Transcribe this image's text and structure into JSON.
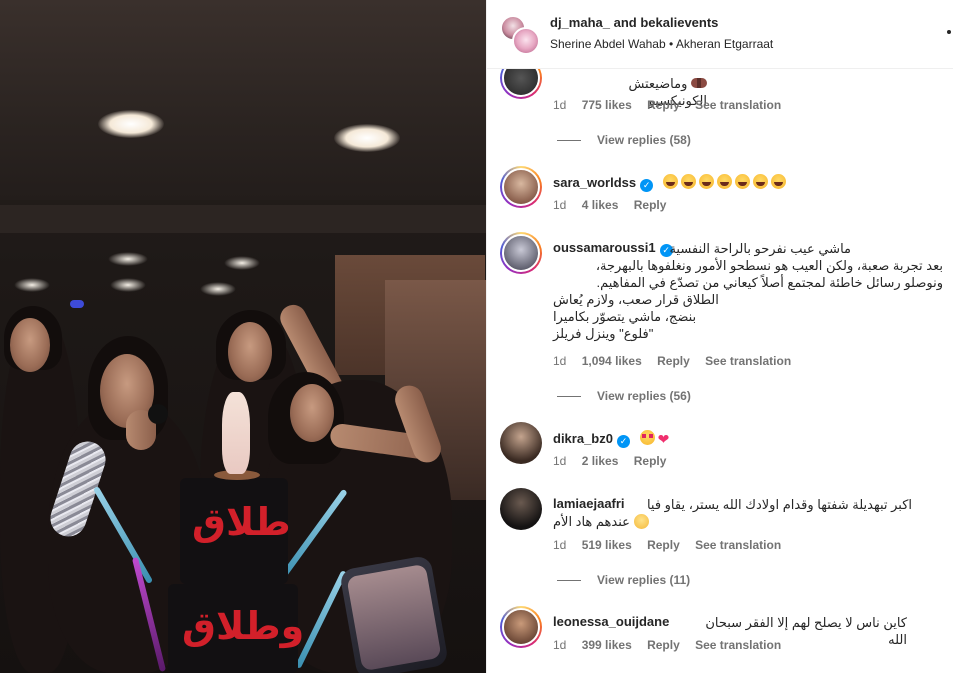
{
  "post": {
    "author_primary": "dj_maha_",
    "author_joiner": "and",
    "author_secondary": "bekalievents",
    "audio_artist": "Sherine Abdel Wahab",
    "audio_separator": "•",
    "audio_title": "Akheran Etgarraat"
  },
  "media": {
    "cake_text_top": "طلاق",
    "cake_text_bottom": "وطلاق"
  },
  "comments": [
    {
      "username": "",
      "text": "وماضيعتش الكونيكسيو",
      "emoji": "bow-icon",
      "time": "1d",
      "likes": "775 likes",
      "reply_label": "Reply",
      "translate_label": "See translation",
      "view_replies": "View replies (58)"
    },
    {
      "username": "sara_worldss",
      "verified": true,
      "text": "😂😂😂😂😂😂😂",
      "time": "1d",
      "likes": "4 likes",
      "reply_label": "Reply"
    },
    {
      "username": "oussamaroussi1",
      "verified": true,
      "lines": [
        "ماشي عيب نفرحو بالراحة النفسية",
        "بعد تجربة صعبة، ولكن العيب هو نسطحو الأمور ونغلفوها بالبهرجة،",
        "ونوصلو رسائل خاطئة لمجتمع أصلاً كيعاني من تصدّع في المفاهيم.",
        "الطلاق قرار صعب، ولازم يُعاش",
        "بنضج، ماشي يتصوّر بكاميرا",
        "\"فلوع\" وينزل فريلز"
      ],
      "time": "1d",
      "likes": "1,094 likes",
      "reply_label": "Reply",
      "translate_label": "See translation",
      "view_replies": "View replies (56)"
    },
    {
      "username": "dikra_bz0",
      "verified": true,
      "time": "1d",
      "likes": "2 likes",
      "reply_label": "Reply"
    },
    {
      "username": "lamiaejaafri",
      "verified": false,
      "text": "اكبر تبهديلة شفتها وقدام اولادك الله يستر، يقاو فيا",
      "text2": "عندهم هاد الأم",
      "time": "1d",
      "likes": "519 likes",
      "reply_label": "Reply",
      "translate_label": "See translation",
      "view_replies": "View replies (11)"
    },
    {
      "username": "leonessa_ouijdane",
      "verified": false,
      "text": "كاين ناس لا يصلح لهم إلا الفقر سبحان الله",
      "time": "1d",
      "likes": "399 likes",
      "reply_label": "Reply",
      "translate_label": "See translation"
    }
  ],
  "colors": {
    "verified": "#0095f6",
    "meta_text": "#737373",
    "primary_text": "#262626",
    "cake_text": "#d2202a"
  }
}
